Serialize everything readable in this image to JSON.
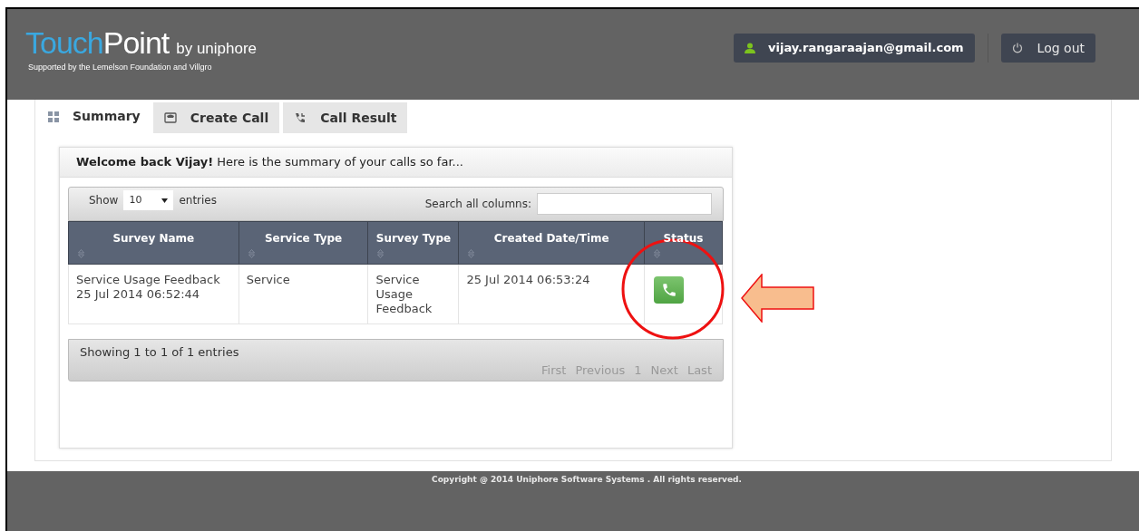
{
  "header": {
    "logo": {
      "touch": "Touch",
      "point": "Point",
      "by": "by uniphore"
    },
    "tagline": "Supported by the Lemelson Foundation and Villgro",
    "user": "vijay.rangaraajan@gmail.com",
    "logout": "Log out"
  },
  "tabs": [
    {
      "label": "Summary",
      "kind": "grid",
      "selected": true
    },
    {
      "label": "Create Call",
      "kind": "phone-box",
      "selected": false
    },
    {
      "label": "Call Result",
      "kind": "phone-in",
      "selected": false
    }
  ],
  "welcome": "**Welcome back Vijay!** Here is the summary of your calls so far...",
  "table_controls": {
    "show": "Show",
    "page_size": "10",
    "entries": "entries",
    "search_label": "Search all columns:"
  },
  "table": {
    "columns": [
      "Survey Name",
      "Service Type",
      "Survey Type",
      "Created Date/Time",
      "Status"
    ],
    "rows": [
      {
        "cells": [
          "Service Usage Feedback 25 Jul 2014 06:52:44",
          "Service",
          "Service Usage Feedback",
          "25 Jul 2014 06:53:24"
        ],
        "kind": "call"
      }
    ]
  },
  "table_footer": {
    "info": "Showing 1 to 1 of 1 entries",
    "pages": [
      "First",
      "Previous",
      "1",
      "Next",
      "Last"
    ]
  },
  "footer": "Copyright @ 2014 Uniphore Software Systems . All rights reserved."
}
